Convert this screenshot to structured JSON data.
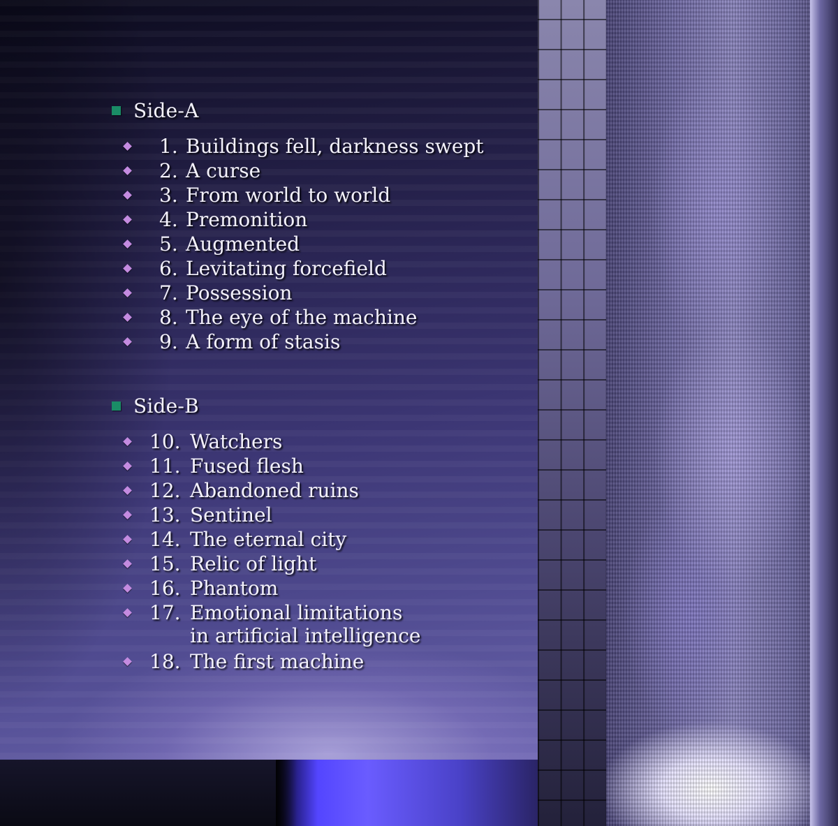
{
  "tracklist": {
    "side_a": {
      "title": "Side-A",
      "tracks": [
        {
          "num": "1.",
          "title": "Buildings fell, darkness swept"
        },
        {
          "num": "2.",
          "title": "A curse"
        },
        {
          "num": "3.",
          "title": "From world to world"
        },
        {
          "num": "4.",
          "title": "Premonition"
        },
        {
          "num": "5.",
          "title": "Augmented"
        },
        {
          "num": "6.",
          "title": "Levitating forcefield"
        },
        {
          "num": "7.",
          "title": "Possession"
        },
        {
          "num": "8.",
          "title": "The eye of the machine"
        },
        {
          "num": "9.",
          "title": "A form of stasis"
        }
      ]
    },
    "side_b": {
      "title": "Side-B",
      "tracks": [
        {
          "num": "10.",
          "title": "Watchers"
        },
        {
          "num": "11.",
          "title": "Fused flesh"
        },
        {
          "num": "12.",
          "title": "Abandoned ruins"
        },
        {
          "num": "13.",
          "title": "Sentinel"
        },
        {
          "num": "14.",
          "title": "The eternal city"
        },
        {
          "num": "15.",
          "title": "Relic of light"
        },
        {
          "num": "16.",
          "title": "Phantom"
        },
        {
          "num": "17.",
          "title": "Emotional limitations",
          "title_line2": "in artificial intelligence"
        },
        {
          "num": "18.",
          "title": "The first machine"
        }
      ]
    }
  },
  "colors": {
    "bullet_square": "#1a8c66",
    "bullet_diamond": "#c48be0",
    "text": "#f3f1fb"
  }
}
